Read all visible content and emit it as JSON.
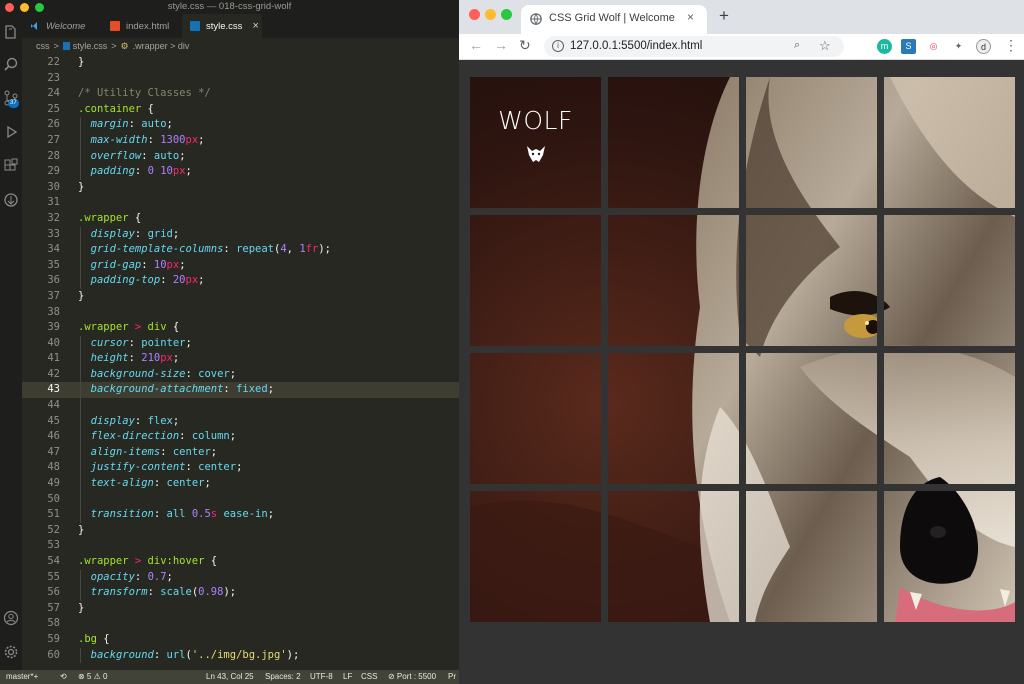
{
  "editor": {
    "window_title": "style.css — 018-css-grid-wolf",
    "tabs": [
      {
        "label": "Welcome",
        "icon": "vscode-icon"
      },
      {
        "label": "index.html",
        "icon": "html-file-icon"
      },
      {
        "label": "style.css",
        "icon": "css-file-icon",
        "close": "×"
      }
    ],
    "breadcrumb": [
      "css",
      ">",
      "style.css",
      ">",
      ".wrapper > div"
    ],
    "scm_badge": "37",
    "code_lines": [
      {
        "n": "22",
        "parts": [
          [
            "p",
            "}"
          ]
        ]
      },
      {
        "n": "23",
        "parts": []
      },
      {
        "n": "24",
        "parts": [
          [
            "com",
            "/* Utility Classes */"
          ]
        ]
      },
      {
        "n": "25",
        "parts": [
          [
            "sel",
            ".container"
          ],
          [
            "p",
            " {"
          ]
        ]
      },
      {
        "n": "26",
        "indent": true,
        "parts": [
          [
            "p",
            "  "
          ],
          [
            "prop",
            "margin"
          ],
          [
            "p",
            ": "
          ],
          [
            "val",
            "auto"
          ],
          [
            "p",
            ";"
          ]
        ]
      },
      {
        "n": "27",
        "indent": true,
        "parts": [
          [
            "p",
            "  "
          ],
          [
            "prop",
            "max-width"
          ],
          [
            "p",
            ": "
          ],
          [
            "num",
            "1300"
          ],
          [
            "unit",
            "px"
          ],
          [
            "p",
            ";"
          ]
        ]
      },
      {
        "n": "28",
        "indent": true,
        "parts": [
          [
            "p",
            "  "
          ],
          [
            "prop",
            "overflow"
          ],
          [
            "p",
            ": "
          ],
          [
            "val",
            "auto"
          ],
          [
            "p",
            ";"
          ]
        ]
      },
      {
        "n": "29",
        "indent": true,
        "parts": [
          [
            "p",
            "  "
          ],
          [
            "prop",
            "padding"
          ],
          [
            "p",
            ": "
          ],
          [
            "num",
            "0"
          ],
          [
            "p",
            " "
          ],
          [
            "num",
            "10"
          ],
          [
            "unit",
            "px"
          ],
          [
            "p",
            ";"
          ]
        ]
      },
      {
        "n": "30",
        "parts": [
          [
            "p",
            "}"
          ]
        ]
      },
      {
        "n": "31",
        "parts": []
      },
      {
        "n": "32",
        "parts": [
          [
            "sel",
            ".wrapper"
          ],
          [
            "p",
            " {"
          ]
        ]
      },
      {
        "n": "33",
        "indent": true,
        "parts": [
          [
            "p",
            "  "
          ],
          [
            "prop",
            "display"
          ],
          [
            "p",
            ": "
          ],
          [
            "val",
            "grid"
          ],
          [
            "p",
            ";"
          ]
        ]
      },
      {
        "n": "34",
        "indent": true,
        "parts": [
          [
            "p",
            "  "
          ],
          [
            "prop",
            "grid-template-columns"
          ],
          [
            "p",
            ": "
          ],
          [
            "val",
            "repeat"
          ],
          [
            "p",
            "("
          ],
          [
            "num",
            "4"
          ],
          [
            "p",
            ", "
          ],
          [
            "num",
            "1"
          ],
          [
            "unit",
            "fr"
          ],
          [
            "p",
            ");"
          ]
        ]
      },
      {
        "n": "35",
        "indent": true,
        "parts": [
          [
            "p",
            "  "
          ],
          [
            "prop",
            "grid-gap"
          ],
          [
            "p",
            ": "
          ],
          [
            "num",
            "10"
          ],
          [
            "unit",
            "px"
          ],
          [
            "p",
            ";"
          ]
        ]
      },
      {
        "n": "36",
        "indent": true,
        "parts": [
          [
            "p",
            "  "
          ],
          [
            "prop",
            "padding-top"
          ],
          [
            "p",
            ": "
          ],
          [
            "num",
            "20"
          ],
          [
            "unit",
            "px"
          ],
          [
            "p",
            ";"
          ]
        ]
      },
      {
        "n": "37",
        "parts": [
          [
            "p",
            "}"
          ]
        ]
      },
      {
        "n": "38",
        "parts": []
      },
      {
        "n": "39",
        "parts": [
          [
            "sel",
            ".wrapper"
          ],
          [
            "op",
            " > "
          ],
          [
            "sel",
            "div"
          ],
          [
            "p",
            " {"
          ]
        ]
      },
      {
        "n": "40",
        "indent": true,
        "parts": [
          [
            "p",
            "  "
          ],
          [
            "prop",
            "cursor"
          ],
          [
            "p",
            ": "
          ],
          [
            "val",
            "pointer"
          ],
          [
            "p",
            ";"
          ]
        ]
      },
      {
        "n": "41",
        "indent": true,
        "parts": [
          [
            "p",
            "  "
          ],
          [
            "prop",
            "height"
          ],
          [
            "p",
            ": "
          ],
          [
            "num",
            "210"
          ],
          [
            "unit",
            "px"
          ],
          [
            "p",
            ";"
          ]
        ]
      },
      {
        "n": "42",
        "indent": true,
        "parts": [
          [
            "p",
            "  "
          ],
          [
            "prop",
            "background-size"
          ],
          [
            "p",
            ": "
          ],
          [
            "val",
            "cover"
          ],
          [
            "p",
            ";"
          ]
        ]
      },
      {
        "n": "43",
        "indent": true,
        "current": true,
        "parts": [
          [
            "p",
            "  "
          ],
          [
            "prop",
            "background-attachment"
          ],
          [
            "p",
            ": "
          ],
          [
            "val",
            "fixed"
          ],
          [
            "p",
            ";"
          ]
        ]
      },
      {
        "n": "44",
        "indent": true,
        "parts": []
      },
      {
        "n": "45",
        "indent": true,
        "parts": [
          [
            "p",
            "  "
          ],
          [
            "prop",
            "display"
          ],
          [
            "p",
            ": "
          ],
          [
            "val",
            "flex"
          ],
          [
            "p",
            ";"
          ]
        ]
      },
      {
        "n": "46",
        "indent": true,
        "parts": [
          [
            "p",
            "  "
          ],
          [
            "prop",
            "flex-direction"
          ],
          [
            "p",
            ": "
          ],
          [
            "val",
            "column"
          ],
          [
            "p",
            ";"
          ]
        ]
      },
      {
        "n": "47",
        "indent": true,
        "parts": [
          [
            "p",
            "  "
          ],
          [
            "prop",
            "align-items"
          ],
          [
            "p",
            ": "
          ],
          [
            "val",
            "center"
          ],
          [
            "p",
            ";"
          ]
        ]
      },
      {
        "n": "48",
        "indent": true,
        "parts": [
          [
            "p",
            "  "
          ],
          [
            "prop",
            "justify-content"
          ],
          [
            "p",
            ": "
          ],
          [
            "val",
            "center"
          ],
          [
            "p",
            ";"
          ]
        ]
      },
      {
        "n": "49",
        "indent": true,
        "parts": [
          [
            "p",
            "  "
          ],
          [
            "prop",
            "text-align"
          ],
          [
            "p",
            ": "
          ],
          [
            "val",
            "center"
          ],
          [
            "p",
            ";"
          ]
        ]
      },
      {
        "n": "50",
        "indent": true,
        "parts": []
      },
      {
        "n": "51",
        "indent": true,
        "parts": [
          [
            "p",
            "  "
          ],
          [
            "prop",
            "transition"
          ],
          [
            "p",
            ": "
          ],
          [
            "val",
            "all"
          ],
          [
            "p",
            " "
          ],
          [
            "num",
            "0.5"
          ],
          [
            "unit",
            "s"
          ],
          [
            "p",
            " "
          ],
          [
            "val",
            "ease-in"
          ],
          [
            "p",
            ";"
          ]
        ]
      },
      {
        "n": "52",
        "parts": [
          [
            "p",
            "}"
          ]
        ]
      },
      {
        "n": "53",
        "parts": []
      },
      {
        "n": "54",
        "parts": [
          [
            "sel",
            ".wrapper"
          ],
          [
            "op",
            " > "
          ],
          [
            "sel",
            "div:hover"
          ],
          [
            "p",
            " {"
          ]
        ]
      },
      {
        "n": "55",
        "indent": true,
        "parts": [
          [
            "p",
            "  "
          ],
          [
            "prop",
            "opacity"
          ],
          [
            "p",
            ": "
          ],
          [
            "num",
            "0.7"
          ],
          [
            "p",
            ";"
          ]
        ]
      },
      {
        "n": "56",
        "indent": true,
        "parts": [
          [
            "p",
            "  "
          ],
          [
            "prop",
            "transform"
          ],
          [
            "p",
            ": "
          ],
          [
            "val",
            "scale"
          ],
          [
            "p",
            "("
          ],
          [
            "num",
            "0.98"
          ],
          [
            "p",
            ");"
          ]
        ]
      },
      {
        "n": "57",
        "parts": [
          [
            "p",
            "}"
          ]
        ]
      },
      {
        "n": "58",
        "parts": []
      },
      {
        "n": "59",
        "parts": [
          [
            "sel",
            ".bg"
          ],
          [
            "p",
            " {"
          ]
        ]
      },
      {
        "n": "60",
        "indent": true,
        "parts": [
          [
            "p",
            "  "
          ],
          [
            "prop",
            "background"
          ],
          [
            "p",
            ": "
          ],
          [
            "val",
            "url"
          ],
          [
            "p",
            "("
          ],
          [
            "str",
            "'../img/bg.jpg'"
          ],
          [
            "p",
            ");"
          ]
        ]
      }
    ],
    "status": {
      "branch": "master*+",
      "problems": "⊗ 5 ⚠ 0",
      "position": "Ln 43, Col 25",
      "spaces": "Spaces: 2",
      "encoding": "UTF-8",
      "eol": "LF",
      "language": "CSS",
      "port": "⊘ Port : 5500",
      "extra": "Pr"
    }
  },
  "browser": {
    "tab_title": "CSS Grid Wolf | Welcome",
    "tab_close": "×",
    "new_tab": "+",
    "url": "127.0.0.1:5500/index.html",
    "extensions": [
      "m",
      "S",
      "◎",
      "✦",
      "d"
    ],
    "page": {
      "logo_text": "WOLF"
    }
  },
  "colors": {
    "editor_bg": "#272822",
    "browser_bg": "#333333",
    "accent_badge": "#0e70c0"
  }
}
